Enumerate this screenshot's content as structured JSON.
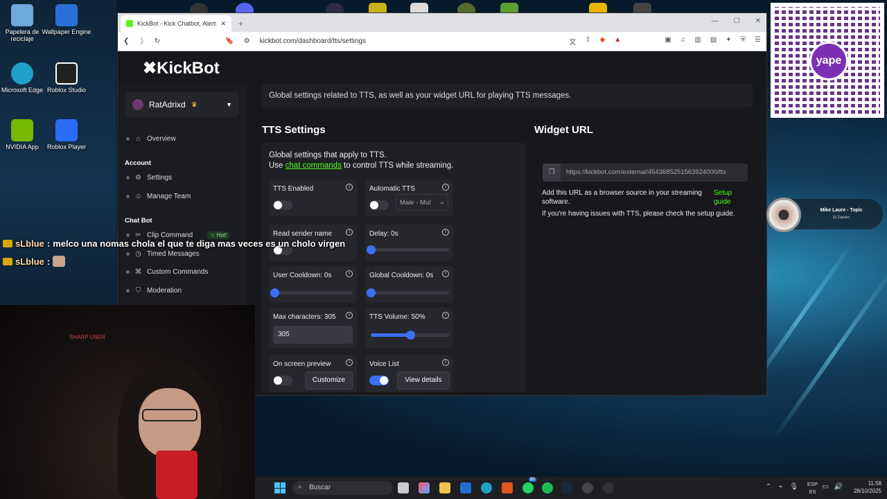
{
  "desktop": {
    "icons": [
      {
        "label": "Papelera de reciclaje",
        "icon": "recycle-bin-icon",
        "color": "#6fa8dc"
      },
      {
        "label": "Wallpaper Engine",
        "icon": "wallpaper-engine-icon",
        "color": "#2a6fd6"
      },
      {
        "label": "Microsoft Edge",
        "icon": "edge-icon",
        "color": "#1fa0c9"
      },
      {
        "label": "Roblox Studio",
        "icon": "roblox-studio-icon",
        "color": "#222222"
      },
      {
        "label": "NVIDIA App",
        "icon": "nvidia-icon",
        "color": "#76b900"
      },
      {
        "label": "Roblox Player",
        "icon": "roblox-player-icon",
        "color": "#2b6cf5"
      }
    ]
  },
  "browser": {
    "tab_title": "KickBot - Kick Chatbot, Alerts, TTS",
    "new_tab": "+",
    "url": "kickbot.com/dashboard/tts/settings"
  },
  "app": {
    "logo": "✖KickBot",
    "user": {
      "name": "RatAdrixd",
      "crown": "♛"
    },
    "nav": {
      "overview": "Overview",
      "account_section": "Account",
      "settings": "Settings",
      "manage_team": "Manage Team",
      "chatbot_section": "Chat Bot",
      "clip_command": "Clip Command",
      "hot_badge": "☆ Hot!",
      "timed_messages": "Timed Messages",
      "custom_commands": "Custom Commands",
      "moderation": "Moderation"
    },
    "banner": "Global settings related to TTS, as well as your widget URL for playing TTS messages.",
    "tts": {
      "title": "TTS Settings",
      "desc_line1": "Global settings that apply to TTS.",
      "desc_use": "Use ",
      "desc_link": "chat commands",
      "desc_rest": " to control TTS while streaming.",
      "tts_enabled": {
        "label": "TTS Enabled",
        "on": false
      },
      "automatic_tts": {
        "label": "Automatic TTS",
        "on": false,
        "voice": "Male - Mul"
      },
      "read_sender": {
        "label": "Read sender name",
        "on": false
      },
      "delay": {
        "label": "Delay: 0s",
        "value": 0
      },
      "user_cooldown": {
        "label": "User Cooldown: 0s",
        "value": 0
      },
      "global_cooldown": {
        "label": "Global Cooldown: 0s",
        "value": 0
      },
      "max_chars": {
        "label": "Max characters: 305",
        "value": "305"
      },
      "volume": {
        "label": "TTS Volume: 50%",
        "value": 0.5
      },
      "preview": {
        "label": "On screen preview",
        "on": false,
        "button": "Customize"
      },
      "voice_list": {
        "label": "Voice List",
        "on": true,
        "button": "View details"
      }
    },
    "widget": {
      "title": "Widget URL",
      "url": "https://kickbot.com/external/4543685251563924000/tts",
      "help1": "Add this URL as a browser source in your streaming software.",
      "setup_link": "Setup guide",
      "help2": "If you're having issues with TTS, please check the setup guide."
    }
  },
  "overlay": {
    "chat": [
      {
        "user": "sLblue",
        "sep": " : ",
        "text": "melco una nomas chola el que te diga mas veces es un cholo virgen"
      },
      {
        "user": "sLblue",
        "sep": " : ",
        "text": ""
      }
    ],
    "cam_label": "SHARP USER",
    "qr_logo": "yape",
    "music": {
      "title": "Mike Laure - Topic",
      "subtitle": "El Zapato"
    }
  },
  "taskbar": {
    "search_placeholder": "Buscar",
    "badge": "50",
    "lang1": "ESP",
    "lang2": "ES",
    "time": "11:58",
    "date": "28/10/2025"
  }
}
